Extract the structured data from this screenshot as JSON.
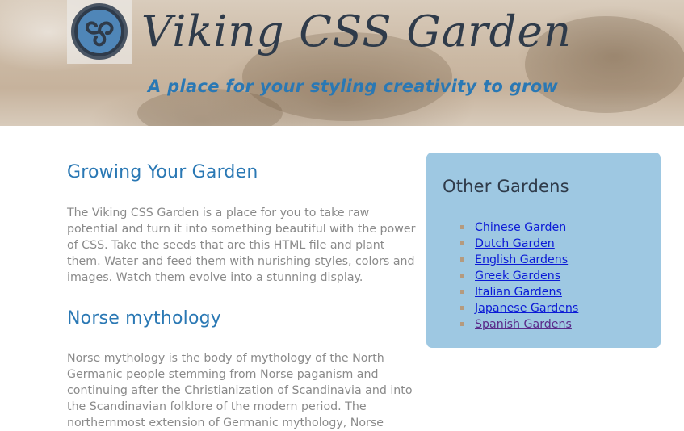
{
  "header": {
    "title": "Viking CSS Garden",
    "tagline": "A place for your styling creativity to grow",
    "logo_icon": "triskele-icon"
  },
  "main": {
    "sections": [
      {
        "title": "Growing Your Garden",
        "text": "The Viking CSS Garden is a place for you to take raw potential and turn it into something beautiful with the power of CSS. Take the seeds that are this HTML file and plant them. Water and feed them with nurishing styles, colors and images. Watch them evolve into a stunning display."
      },
      {
        "title": "Norse mythology",
        "text": "Norse mythology is the body of mythology of the North Germanic people stemming from Norse paganism and continuing after the Christianization of Scandinavia and into the Scandinavian folklore of the modern period. The northernmost extension of Germanic mythology, Norse"
      }
    ]
  },
  "sidebar": {
    "title": "Other Gardens",
    "links": [
      {
        "label": "Chinese Garden"
      },
      {
        "label": "Dutch Garden"
      },
      {
        "label": "English Gardens"
      },
      {
        "label": "Greek Gardens"
      },
      {
        "label": "Italian Gardens"
      },
      {
        "label": "Japanese Gardens"
      },
      {
        "label": "Spanish Gardens"
      }
    ]
  },
  "colors": {
    "accent_blue": "#2a78b4",
    "sidebar_bg": "#9ec8e2",
    "link": "#0b1ad6",
    "link_visited": "#5a2a8a",
    "body_text": "#8a8a8a"
  }
}
